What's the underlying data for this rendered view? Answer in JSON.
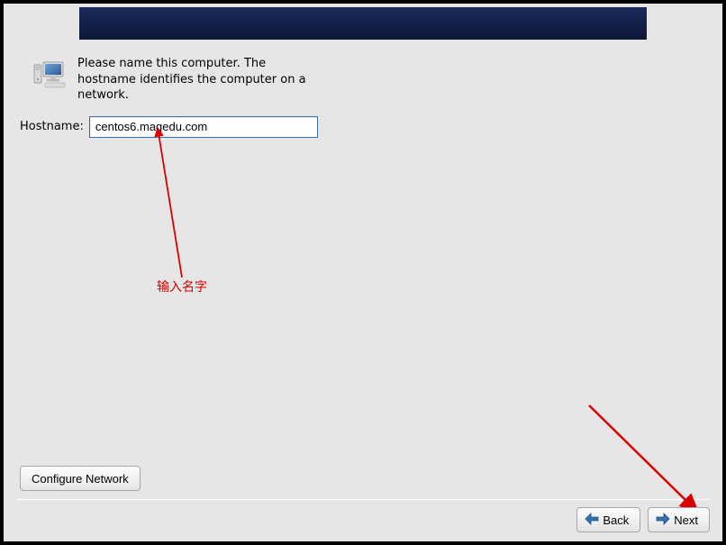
{
  "instruction_text": "Please name this computer.  The hostname identifies the computer on a network.",
  "hostname": {
    "label": "Hostname:",
    "value": "centos6.magedu.com"
  },
  "buttons": {
    "configure_network": "Configure Network",
    "back": "Back",
    "next": "Next"
  },
  "annotation": {
    "text": "输入名字"
  },
  "colors": {
    "annotation": "#d80000",
    "banner_top": "#1a2a5a",
    "banner_bottom": "#0e1938",
    "arrow_blue": "#2e74b5"
  }
}
